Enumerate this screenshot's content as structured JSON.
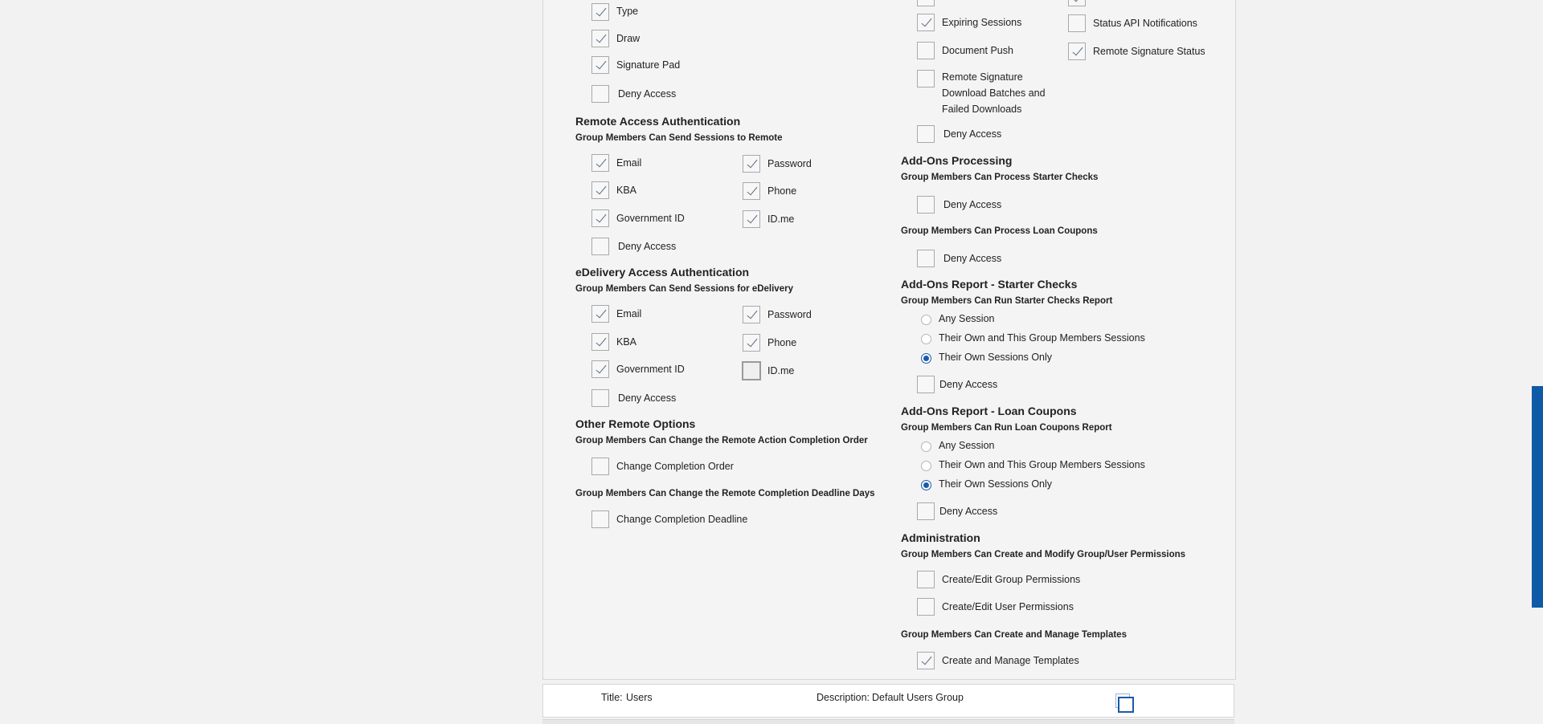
{
  "left": {
    "signature": {
      "type": "Type",
      "draw": "Draw",
      "pad": "Signature Pad",
      "deny": "Deny Access"
    },
    "remote": {
      "title": "Remote Access Authentication",
      "subtitle": "Group Members Can Send Sessions to Remote",
      "email": "Email",
      "password": "Password",
      "kba": "KBA",
      "phone": "Phone",
      "gov": "Government ID",
      "idme": "ID.me",
      "deny": "Deny Access"
    },
    "edelivery": {
      "title": "eDelivery Access Authentication",
      "subtitle": "Group Members Can Send Sessions for eDelivery",
      "email": "Email",
      "password": "Password",
      "kba": "KBA",
      "phone": "Phone",
      "gov": "Government ID",
      "idme": "ID.me",
      "deny": "Deny Access"
    },
    "other": {
      "title": "Other Remote Options",
      "subtitle1": "Group Members Can Change the Remote Action Completion Order",
      "change_order": "Change Completion Order",
      "subtitle2": "Group Members Can Change the Remote Completion Deadline Days",
      "change_deadline": "Change Completion Deadline"
    }
  },
  "right": {
    "notifications": {
      "expiring": "Expiring Sessions",
      "status_api": "Status API Notifications",
      "doc_push": "Document Push",
      "remote_sig_status": "Remote Signature Status",
      "remote_sig_download": "Remote Signature Download Batches and Failed Downloads",
      "deny": "Deny Access"
    },
    "addons_processing": {
      "title": "Add-Ons Processing",
      "sub_starter": "Group Members Can Process Starter Checks",
      "deny1": "Deny Access",
      "sub_loan": "Group Members Can Process Loan Coupons",
      "deny2": "Deny Access"
    },
    "report_starter": {
      "title": "Add-Ons Report - Starter Checks",
      "subtitle": "Group Members Can Run Starter Checks Report",
      "any": "Any Session",
      "own_group": "Their Own and This Group Members Sessions",
      "own_only": "Their Own Sessions Only",
      "deny": "Deny Access"
    },
    "report_loan": {
      "title": "Add-Ons Report - Loan Coupons",
      "subtitle": "Group Members Can Run Loan Coupons Report",
      "any": "Any Session",
      "own_group": "Their Own and This Group Members Sessions",
      "own_only": "Their Own Sessions Only",
      "deny": "Deny Access"
    },
    "admin": {
      "title": "Administration",
      "subtitle": "Group Members Can Create and Modify Group/User Permissions",
      "group_perm": "Create/Edit Group Permissions",
      "user_perm": "Create/Edit User Permissions",
      "sub_templates": "Group Members Can Create and Manage Templates",
      "templates": "Create and Manage Templates"
    }
  },
  "footer": {
    "title_label": "Title:",
    "title_value": "Users",
    "desc_label": "Description:",
    "desc_value": "Default Users Group"
  }
}
